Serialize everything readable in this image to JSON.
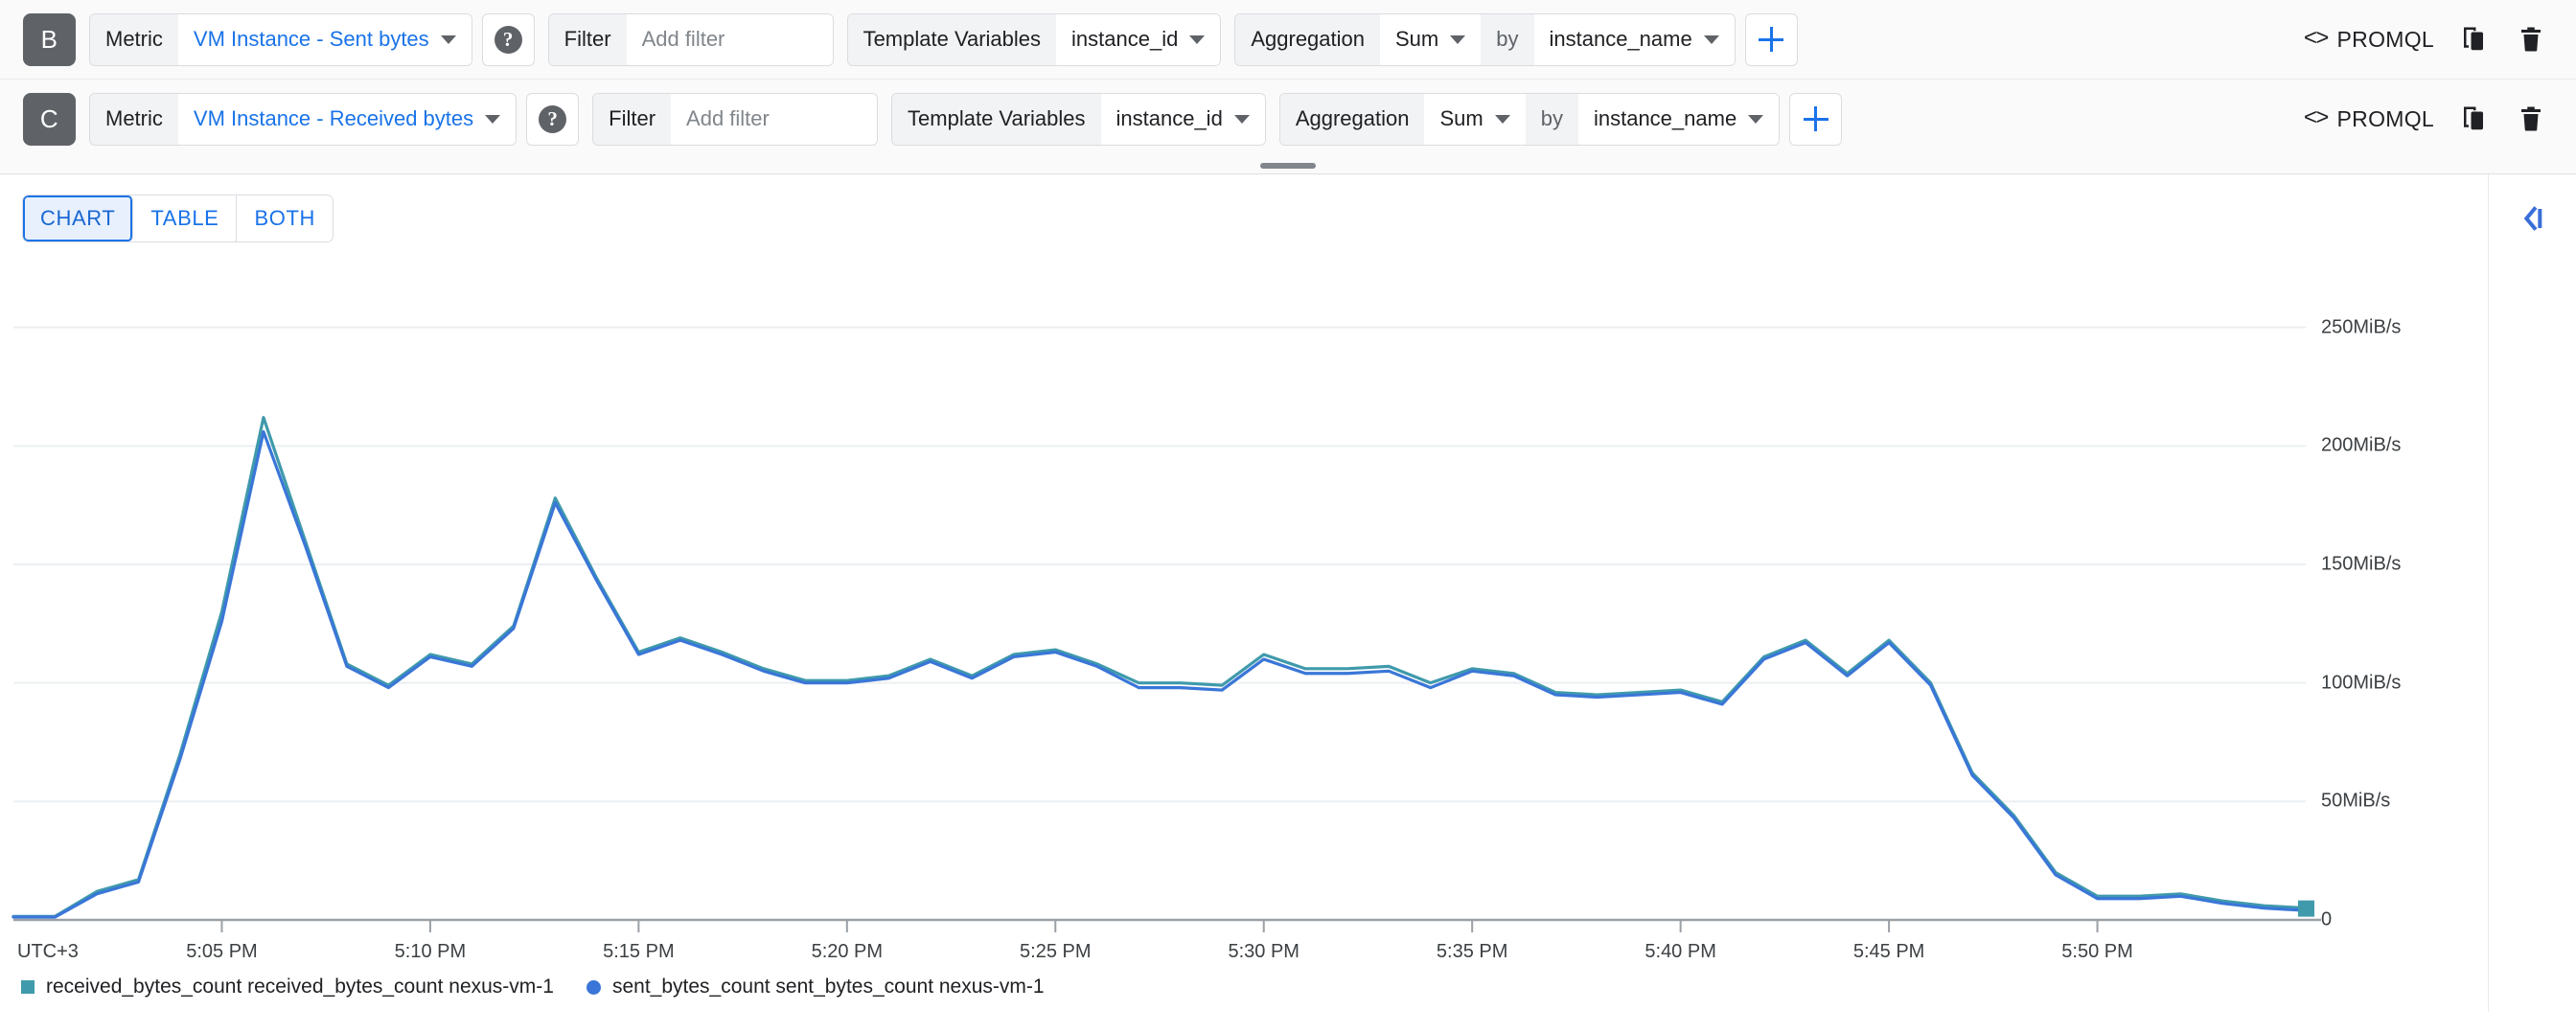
{
  "query_rows": [
    {
      "badge": "B",
      "metric_label": "Metric",
      "metric_value": "VM Instance - Sent bytes",
      "help_glyph": "?",
      "filter_label": "Filter",
      "filter_value": "",
      "filter_placeholder": "Add filter",
      "template_variables_label": "Template Variables",
      "template_variables_value": "instance_id",
      "aggregation_label": "Aggregation",
      "aggregation_value": "Sum",
      "by_label": "by",
      "by_value": "instance_name",
      "add_label": "+",
      "promql_label": "PROMQL",
      "promql_glyph": "<>",
      "duplicate_icon": "duplicate-icon",
      "delete_icon": "trash-icon"
    },
    {
      "badge": "C",
      "metric_label": "Metric",
      "metric_value": "VM Instance - Received bytes",
      "help_glyph": "?",
      "filter_label": "Filter",
      "filter_value": "",
      "filter_placeholder": "Add filter",
      "template_variables_label": "Template Variables",
      "template_variables_value": "instance_id",
      "aggregation_label": "Aggregation",
      "aggregation_value": "Sum",
      "by_label": "by",
      "by_value": "instance_name",
      "add_label": "+",
      "promql_label": "PROMQL",
      "promql_glyph": "<>",
      "duplicate_icon": "duplicate-icon",
      "delete_icon": "trash-icon"
    }
  ],
  "view_toggle": {
    "options": [
      "CHART",
      "TABLE",
      "BOTH"
    ],
    "selected": "CHART"
  },
  "right_rail": {
    "collapse_label": "collapse-panel"
  },
  "colors": {
    "received_series": "#3f9aab",
    "sent_series": "#3a76d8",
    "accent": "#1a73e8",
    "badge_bg": "#5f6368",
    "grid": "#eceff1",
    "axis": "#9aa0a6"
  },
  "chart_data": {
    "type": "line",
    "title": "",
    "xlabel": "",
    "ylabel": "",
    "timezone_label": "UTC+3",
    "ylim": [
      0,
      262
    ],
    "yunit": "MiB/s",
    "ytick_values": [
      0,
      50,
      100,
      150,
      200,
      250
    ],
    "ytick_labels": [
      "0",
      "50MiB/s",
      "100MiB/s",
      "150MiB/s",
      "200MiB/s",
      "250MiB/s"
    ],
    "xtick_labels": [
      "5:05 PM",
      "5:10 PM",
      "5:15 PM",
      "5:20 PM",
      "5:25 PM",
      "5:30 PM",
      "5:35 PM",
      "5:40 PM",
      "5:45 PM",
      "5:50 PM"
    ],
    "x_minutes": [
      0,
      1,
      2,
      3,
      4,
      5,
      6,
      7,
      8,
      9,
      10,
      11,
      12,
      13,
      14,
      15,
      16,
      17,
      18,
      19,
      20,
      21,
      22,
      23,
      24,
      25,
      26,
      27,
      28,
      29,
      30,
      31,
      32,
      33,
      34,
      35,
      36,
      37,
      38,
      39,
      40,
      41,
      42,
      43,
      44,
      45,
      46,
      47,
      48,
      49,
      50
    ],
    "grid": true,
    "legend_position": "bottom-left",
    "series": [
      {
        "name": "received_bytes_count received_bytes_count nexus-vm-1",
        "color": "#3f9aab",
        "values": [
          1.5,
          1.5,
          12,
          17,
          70,
          130,
          212,
          160,
          108,
          99,
          112,
          108,
          124,
          178,
          144,
          113,
          119,
          113,
          106,
          101,
          101,
          103,
          110,
          103,
          112,
          114,
          108,
          100,
          100,
          99,
          112,
          106,
          106,
          107,
          100,
          106,
          104,
          96,
          95,
          96,
          97,
          92,
          111,
          118,
          104,
          118,
          100,
          62,
          44,
          20,
          10,
          10,
          11,
          8,
          6,
          5
        ]
      },
      {
        "name": "sent_bytes_count sent_bytes_count nexus-vm-1",
        "color": "#3a76d8",
        "values": [
          1.2,
          1.2,
          11,
          16,
          68,
          126,
          206,
          158,
          107,
          98,
          111,
          107,
          123,
          176,
          143,
          112,
          118,
          112,
          105,
          100,
          100,
          102,
          109,
          102,
          111,
          113,
          107,
          98,
          98,
          97,
          110,
          104,
          104,
          105,
          98,
          105,
          103,
          95,
          94,
          95,
          96,
          91,
          110,
          117,
          103,
          117,
          99,
          61,
          43,
          19,
          9,
          9,
          10,
          7,
          5,
          4
        ]
      }
    ]
  },
  "legend": [
    {
      "label": "received_bytes_count received_bytes_count nexus-vm-1",
      "marker": "square",
      "color": "#3f9aab"
    },
    {
      "label": "sent_bytes_count sent_bytes_count nexus-vm-1",
      "marker": "circle",
      "color": "#3a76d8"
    }
  ]
}
